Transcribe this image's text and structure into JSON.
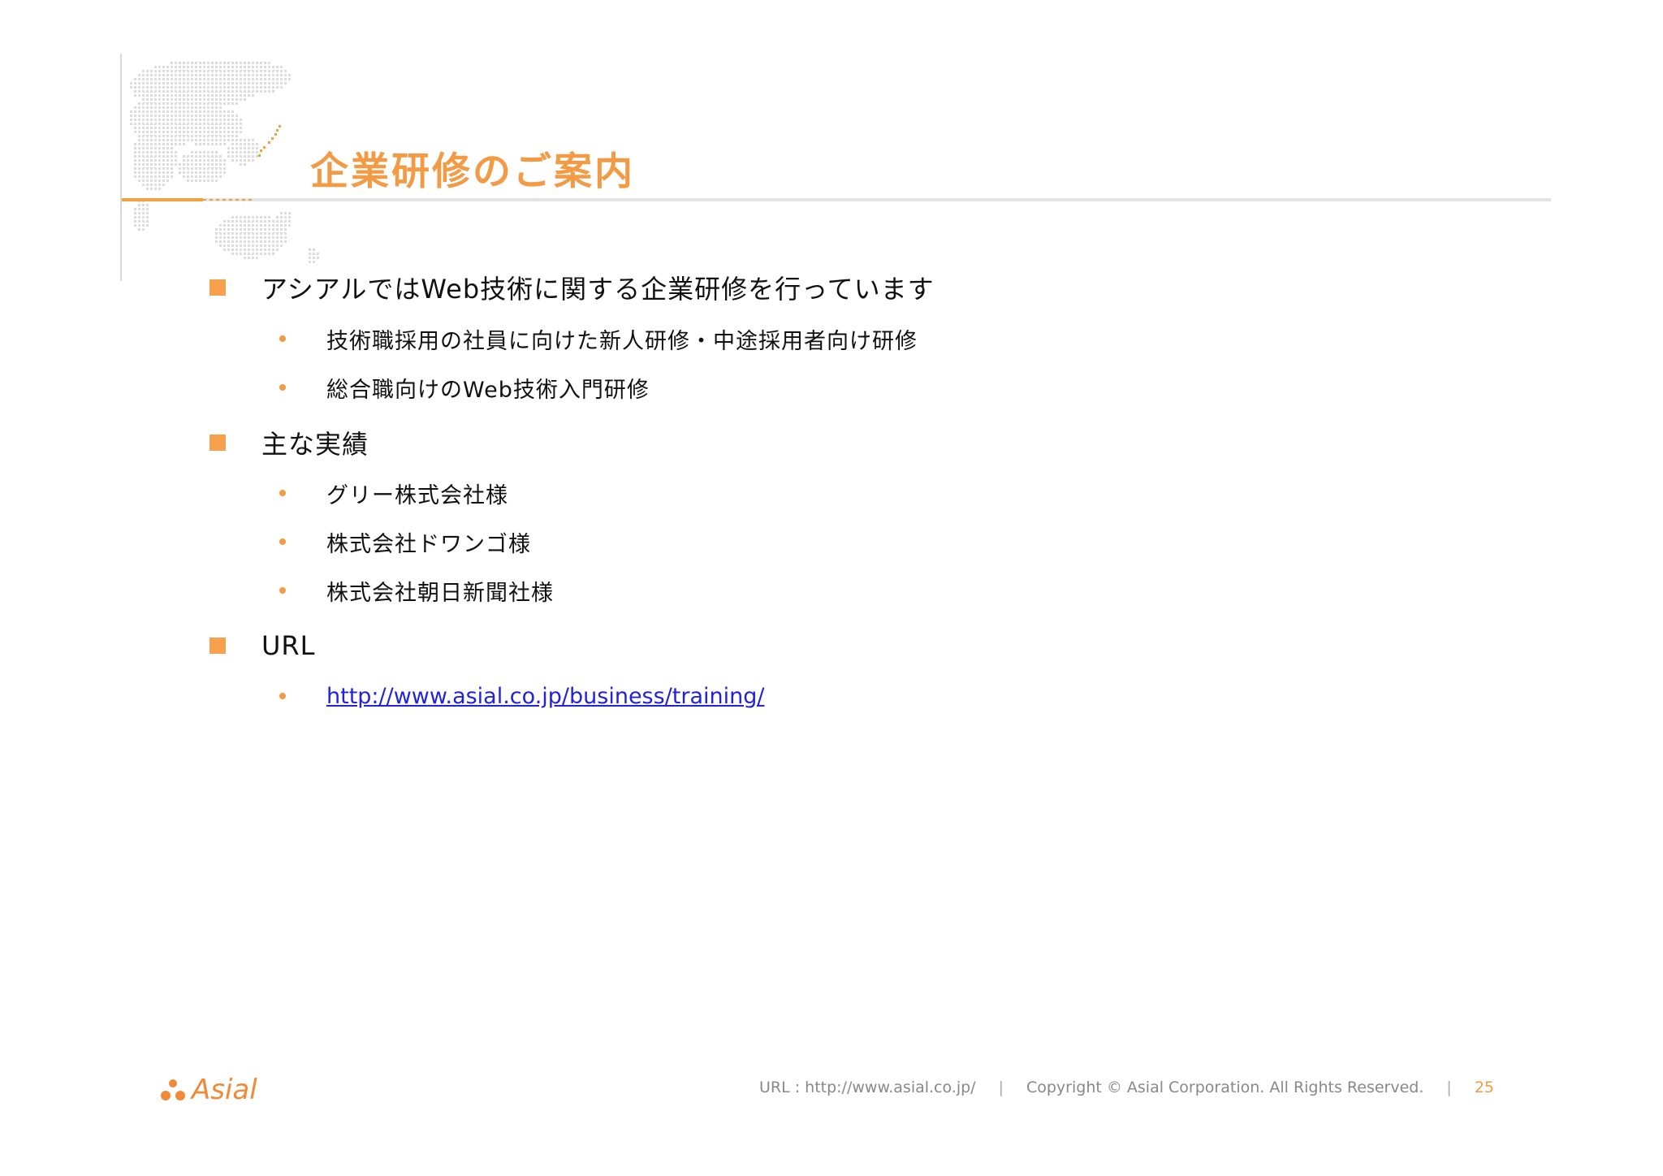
{
  "slide": {
    "title": "企業研修のご案内"
  },
  "sections": [
    {
      "heading": "アシアルではWeb技術に関する企業研修を行っています",
      "items": [
        "技術職採用の社員に向けた新人研修・中途採用者向け研修",
        "総合職向けのWeb技術入門研修"
      ]
    },
    {
      "heading": "主な実績",
      "items": [
        "グリー株式会社様",
        "株式会社ドワンゴ様",
        "株式会社朝日新聞社様"
      ]
    },
    {
      "heading": "URL",
      "items": [
        "http://www.asial.co.jp/business/training/"
      ]
    }
  ],
  "footer": {
    "logo_text": "Asial",
    "url_text": "URL : http://www.asial.co.jp/",
    "separator": "|",
    "copyright": "Copyright ©  Asial Corporation. All Rights Reserved.",
    "page_number": "25"
  },
  "colors": {
    "accent": "#f39a45",
    "link": "#2222dd"
  }
}
